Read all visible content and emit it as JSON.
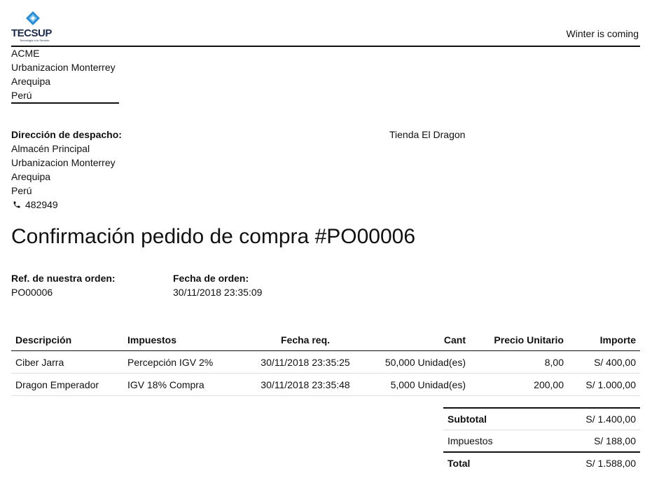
{
  "header": {
    "brand": "TECSUP",
    "tagline": "Tecnología a tu Servicio",
    "motto": "Winter is coming"
  },
  "company_address": [
    "ACME",
    "Urbanizacion Monterrey",
    "Arequipa",
    "Perú"
  ],
  "shipping": {
    "label": "Dirección de despacho:",
    "lines": [
      "Almacén Principal",
      "Urbanizacion Monterrey",
      "Arequipa",
      "Perú"
    ],
    "phone": "482949"
  },
  "vendor": "Tienda El Dragon",
  "title": "Confirmación pedido de compra #PO00006",
  "order_info": {
    "ref_label": "Ref. de nuestra orden:",
    "ref_value": "PO00006",
    "date_label": "Fecha de orden:",
    "date_value": "30/11/2018 23:35:09"
  },
  "lines_table": {
    "headers": [
      "Descripción",
      "Impuestos",
      "Fecha req.",
      "Cant",
      "Precio Unitario",
      "Importe"
    ],
    "rows": [
      [
        "Ciber Jarra",
        "Percepción IGV 2%",
        "30/11/2018 23:35:25",
        "50,000 Unidad(es)",
        "8,00",
        "S/ 400,00"
      ],
      [
        "Dragon Emperador",
        "IGV 18% Compra",
        "30/11/2018 23:35:48",
        "5,000 Unidad(es)",
        "200,00",
        "S/ 1.000,00"
      ]
    ]
  },
  "totals": {
    "subtotal_label": "Subtotal",
    "subtotal_value": "S/ 1.400,00",
    "taxes_label": "Impuestos",
    "taxes_value": "S/ 188,00",
    "total_label": "Total",
    "total_value": "S/ 1.588,00"
  }
}
